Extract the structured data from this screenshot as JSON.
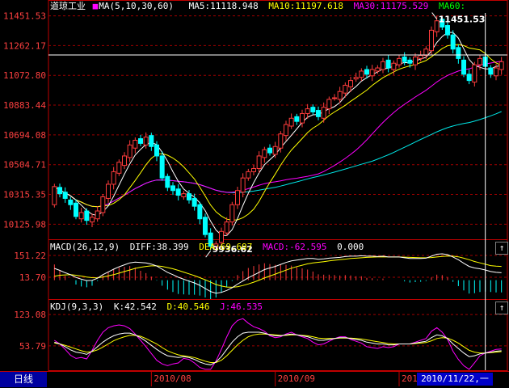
{
  "header": {
    "title": "道琼工业",
    "ma_label": "MA(5,10,30,60)",
    "ma5": "MA5:11118.948",
    "ma10": "MA10:11197.618",
    "ma30": "MA30:11175.529",
    "ma60": "MA60:"
  },
  "macd_header": {
    "label": "MACD(26,12,9)",
    "diff": "DIFF:38.399",
    "dea": "DEA:69.697",
    "macd": "MACD:-62.595",
    "zero": "0.000"
  },
  "kdj_header": {
    "label": "KDJ(9,3,3)",
    "k": "K:42.542",
    "d": "D:40.546",
    "j": "J:46.535"
  },
  "period_button": "日线",
  "cursor_date": "2010/11/22,一",
  "scroll_up": "↑",
  "colors": {
    "up": "#ff3c3c",
    "down": "#00ffff",
    "ma5": "#ffffff",
    "ma10": "#ffff00",
    "ma30": "#ff00ff",
    "ma60": "#00ff00",
    "grid": "#a00000"
  },
  "chart_data": [
    {
      "type": "candlestick",
      "panel": "price",
      "y_ticks": [
        10125.98,
        10315.35,
        10504.71,
        10694.08,
        10883.44,
        11072.8,
        11262.17,
        11451.53
      ],
      "ylim": [
        10030,
        11470
      ],
      "x_ticks": [
        "2010/08",
        "2010/09",
        "2010/10"
      ],
      "annotations": [
        {
          "text": "11451.53",
          "value": 11451.53
        },
        {
          "text": "9936.62",
          "value": 9936.62
        }
      ],
      "close": [
        10365,
        10320,
        10290,
        10250,
        10175,
        10200,
        10150,
        10170,
        10210,
        10300,
        10380,
        10460,
        10520,
        10560,
        10630,
        10660,
        10640,
        10680,
        10620,
        10560,
        10420,
        10360,
        10340,
        10310,
        10320,
        10280,
        10240,
        10160,
        10060,
        9985,
        10000,
        10080,
        10140,
        10250,
        10340,
        10420,
        10460,
        10480,
        10560,
        10600,
        10580,
        10620,
        10700,
        10760,
        10800,
        10780,
        10830,
        10860,
        10840,
        10810,
        10870,
        10920,
        10930,
        10970,
        11010,
        11040,
        11060,
        11100,
        11080,
        11110,
        11120,
        11160,
        11120,
        11150,
        11180,
        11160,
        11150,
        11190,
        11200,
        11240,
        11360,
        11420,
        11380,
        11330,
        11240,
        11180,
        11080,
        11040,
        11140,
        11180,
        11130,
        11080,
        11120,
        11160
      ],
      "open": [
        10250,
        10360,
        10330,
        10280,
        10260,
        10160,
        10210,
        10140,
        10160,
        10200,
        10290,
        10380,
        10450,
        10500,
        10550,
        10610,
        10670,
        10630,
        10690,
        10630,
        10560,
        10430,
        10370,
        10350,
        10300,
        10320,
        10290,
        10250,
        10170,
        10070,
        9980,
        10010,
        10070,
        10140,
        10250,
        10330,
        10420,
        10460,
        10480,
        10550,
        10610,
        10570,
        10610,
        10690,
        10750,
        10810,
        10770,
        10830,
        10870,
        10850,
        10800,
        10860,
        10930,
        10920,
        10960,
        11000,
        11050,
        11060,
        11110,
        11070,
        11100,
        11110,
        11170,
        11110,
        11140,
        11190,
        11170,
        11140,
        11180,
        11200,
        11230,
        11350,
        11430,
        11390,
        11330,
        11250,
        11170,
        11080,
        11030,
        11140,
        11190,
        11120,
        11070,
        11110
      ]
    },
    {
      "type": "line",
      "panel": "macd",
      "y_ticks": [
        151.22,
        13.7
      ],
      "series": [
        {
          "name": "DIFF",
          "values": [
            60,
            50,
            38,
            28,
            14,
            5,
            -2,
            -1,
            10,
            28,
            42,
            56,
            68,
            78,
            88,
            92,
            90,
            88,
            82,
            72,
            56,
            40,
            28,
            15,
            5,
            -5,
            -14,
            -26,
            -42,
            -58,
            -66,
            -62,
            -52,
            -38,
            -20,
            -4,
            12,
            26,
            40,
            54,
            62,
            70,
            80,
            90,
            98,
            102,
            106,
            110,
            110,
            106,
            108,
            112,
            114,
            116,
            120,
            122,
            122,
            124,
            122,
            122,
            120,
            122,
            118,
            118,
            118,
            114,
            110,
            110,
            110,
            112,
            122,
            132,
            134,
            130,
            118,
            104,
            86,
            70,
            62,
            58,
            52,
            44,
            40,
            38
          ]
        },
        {
          "name": "DEA",
          "values": [
            20,
            25,
            27,
            28,
            25,
            21,
            16,
            13,
            12,
            16,
            22,
            28,
            36,
            44,
            52,
            60,
            66,
            70,
            73,
            73,
            70,
            64,
            58,
            50,
            41,
            32,
            23,
            13,
            2,
            -10,
            -22,
            -30,
            -35,
            -36,
            -33,
            -27,
            -19,
            -10,
            0,
            11,
            21,
            31,
            41,
            51,
            61,
            69,
            76,
            83,
            88,
            91,
            94,
            98,
            101,
            104,
            107,
            110,
            112,
            114,
            116,
            117,
            118,
            118,
            118,
            118,
            118,
            117,
            116,
            115,
            114,
            114,
            115,
            118,
            121,
            123,
            122,
            119,
            112,
            104,
            95,
            88,
            81,
            74,
            71,
            70
          ]
        },
        {
          "name": "MACD",
          "values": [
            80,
            50,
            22,
            0,
            -22,
            -32,
            -36,
            -28,
            -4,
            24,
            40,
            56,
            64,
            68,
            72,
            64,
            48,
            36,
            18,
            -2,
            -28,
            -48,
            -60,
            -70,
            -72,
            -74,
            -74,
            -78,
            -88,
            -96,
            -88,
            -64,
            -34,
            -4,
            26,
            46,
            62,
            72,
            80,
            86,
            82,
            78,
            78,
            78,
            74,
            66,
            60,
            54,
            44,
            30,
            28,
            28,
            26,
            24,
            26,
            24,
            20,
            20,
            12,
            10,
            4,
            8,
            0,
            0,
            0,
            -6,
            -12,
            -10,
            -8,
            -4,
            14,
            28,
            26,
            14,
            -8,
            -30,
            -52,
            -68,
            -66,
            -60,
            -58,
            -60,
            -62,
            -62
          ]
        }
      ]
    },
    {
      "type": "line",
      "panel": "kdj",
      "y_ticks": [
        123.08,
        53.79
      ],
      "series": [
        {
          "name": "K",
          "values": [
            62,
            58,
            52,
            45,
            40,
            38,
            35,
            42,
            52,
            62,
            70,
            76,
            80,
            82,
            82,
            78,
            72,
            64,
            55,
            46,
            38,
            32,
            30,
            28,
            30,
            28,
            24,
            18,
            14,
            12,
            18,
            30,
            46,
            62,
            74,
            82,
            84,
            84,
            84,
            82,
            78,
            76,
            76,
            78,
            80,
            78,
            76,
            74,
            70,
            66,
            66,
            68,
            70,
            72,
            72,
            70,
            68,
            66,
            62,
            60,
            58,
            58,
            56,
            56,
            58,
            58,
            58,
            60,
            62,
            64,
            72,
            78,
            76,
            70,
            58,
            48,
            38,
            30,
            32,
            36,
            38,
            40,
            42,
            43
          ]
        },
        {
          "name": "D",
          "values": [
            60,
            58,
            55,
            51,
            47,
            43,
            40,
            41,
            45,
            51,
            58,
            65,
            70,
            74,
            77,
            77,
            75,
            70,
            64,
            58,
            50,
            43,
            38,
            34,
            32,
            30,
            28,
            24,
            20,
            17,
            17,
            22,
            32,
            44,
            56,
            66,
            74,
            78,
            80,
            80,
            79,
            78,
            77,
            77,
            78,
            78,
            77,
            76,
            74,
            71,
            70,
            70,
            70,
            71,
            71,
            71,
            70,
            69,
            67,
            65,
            63,
            61,
            59,
            58,
            58,
            58,
            58,
            59,
            60,
            61,
            65,
            70,
            72,
            71,
            66,
            60,
            52,
            44,
            40,
            38,
            38,
            39,
            40,
            41
          ]
        },
        {
          "name": "J",
          "values": [
            66,
            58,
            46,
            33,
            26,
            28,
            25,
            44,
            66,
            84,
            94,
            98,
            100,
            98,
            92,
            80,
            66,
            52,
            37,
            22,
            14,
            10,
            14,
            16,
            26,
            24,
            16,
            6,
            2,
            2,
            20,
            46,
            74,
            98,
            110,
            114,
            104,
            96,
            92,
            86,
            76,
            72,
            74,
            80,
            84,
            78,
            74,
            70,
            62,
            56,
            58,
            64,
            70,
            74,
            74,
            68,
            64,
            60,
            52,
            50,
            48,
            52,
            50,
            52,
            58,
            58,
            58,
            62,
            66,
            70,
            86,
            94,
            84,
            68,
            42,
            24,
            10,
            2,
            16,
            32,
            38,
            42,
            46,
            47
          ]
        }
      ]
    }
  ]
}
